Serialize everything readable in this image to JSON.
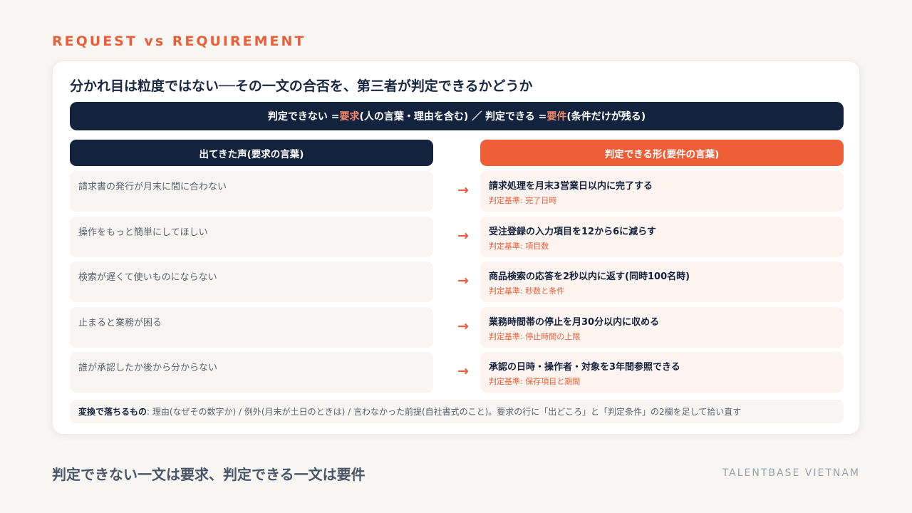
{
  "header": {
    "eyebrow": "REQUEST vs REQUIREMENT"
  },
  "card": {
    "title": "分かれ目は粒度ではない──その一文の合否を、第三者が判定できるかどうか",
    "banner": {
      "part1": "判定できない = ",
      "part1_hl": "要求",
      "part2": "(人の言葉・理由を含む) ／ 判定できる = ",
      "part2_hl": "要件",
      "part3": "(条件だけが残る)"
    },
    "left_header": "出てきた声(要求の言葉)",
    "right_header": "判定できる形(要件の言葉)",
    "arrow": "→",
    "rows": [
      {
        "voice": "請求書の発行が月末に間に合わない",
        "requirement": "請求処理を月末3営業日以内に完了する",
        "criterion": "判定基準: 完了日時"
      },
      {
        "voice": "操作をもっと簡単にしてほしい",
        "requirement": "受注登録の入力項目を12から6に減らす",
        "criterion": "判定基準: 項目数"
      },
      {
        "voice": "検索が遅くて使いものにならない",
        "requirement": "商品検索の応答を2秒以内に返す(同時100名時)",
        "criterion": "判定基準: 秒数と条件"
      },
      {
        "voice": "止まると業務が困る",
        "requirement": "業務時間帯の停止を月30分以内に収める",
        "criterion": "判定基準: 停止時間の上限"
      },
      {
        "voice": "誰が承認したか後から分からない",
        "requirement": "承認の日時・操作者・対象を3年間参照できる",
        "criterion": "判定基準: 保存項目と期間"
      }
    ],
    "footnote": {
      "label": "変換で落ちるもの",
      "text": ": 理由(なぜその数字か) / 例外(月末が土日のときは) / 言わなかった前提(自社書式のこと)。要求の行に「出どころ」と「判定条件」の2欄を足して拾い直す"
    }
  },
  "footer": {
    "summary": "判定できない一文は要求、判定できる一文は要件",
    "brand": "TALENTBASE VIETNAM"
  },
  "colors": {
    "accent": "#ee5e37",
    "navy": "#13233d",
    "background": "#f8f6f3"
  }
}
